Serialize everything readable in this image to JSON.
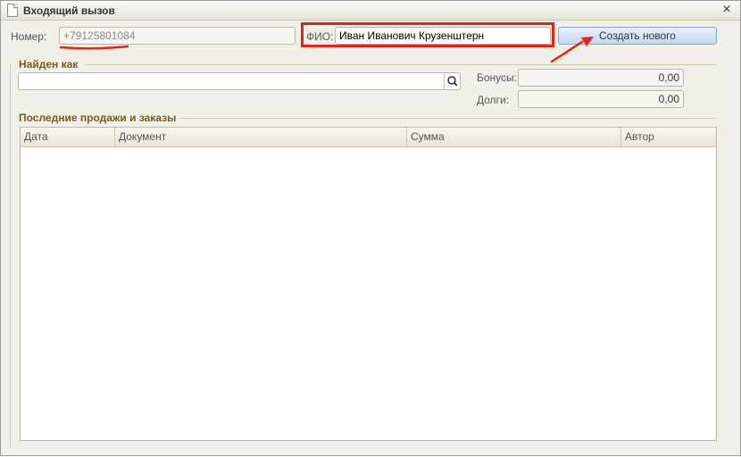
{
  "window": {
    "title": "Входящий вызов"
  },
  "caller": {
    "number_label": "Номер:",
    "number_value": "+79125801084",
    "fio_label": "ФИО:",
    "fio_value": "Иван Иванович Крузенштерн",
    "create_button": "Создать нового"
  },
  "found_as": {
    "title": "Найден как",
    "search_value": "",
    "bonus_label": "Бонусы:",
    "bonus_value": "0,00",
    "debt_label": "Долги:",
    "debt_value": "0,00"
  },
  "sales": {
    "title": "Последние продажи и заказы",
    "columns": [
      "Дата",
      "Документ",
      "Сумма",
      "Автор"
    ],
    "rows": []
  },
  "colors": {
    "annotation_red": "#e2231a",
    "group_title": "#7a5b1a",
    "button_blue": "#c6d8ef"
  },
  "icons": {
    "title": "document-icon",
    "close": "close-icon",
    "search": "search-icon"
  }
}
